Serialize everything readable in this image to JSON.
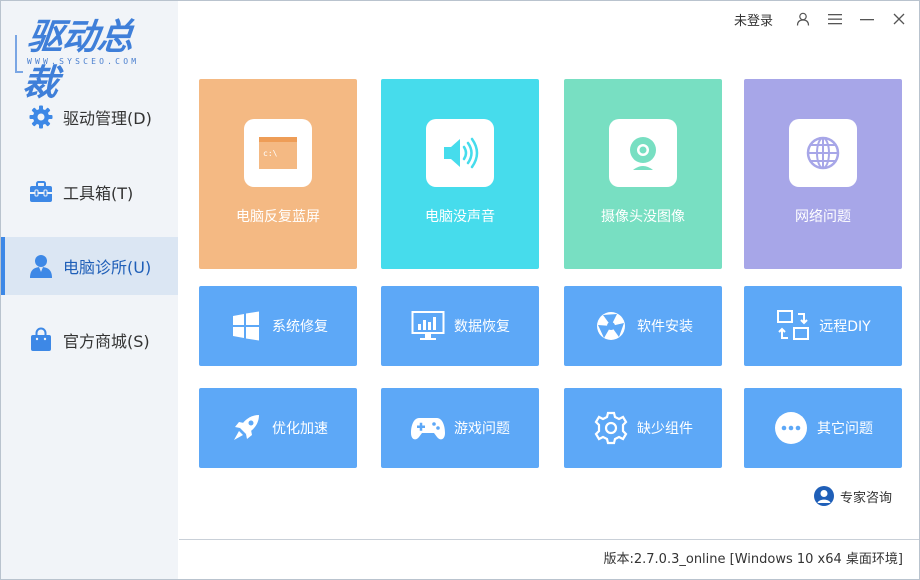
{
  "logo": {
    "main": "驱动总裁",
    "sub": "WWW.SYSCEO.COM"
  },
  "sidebar": {
    "items": [
      {
        "label": "驱动管理(D)",
        "icon": "gear-icon"
      },
      {
        "label": "工具箱(T)",
        "icon": "toolbox-icon"
      },
      {
        "label": "电脑诊所(U)",
        "icon": "doctor-icon",
        "active": true
      },
      {
        "label": "官方商城(S)",
        "icon": "shopping-bag-icon"
      }
    ]
  },
  "topbar": {
    "login": "未登录"
  },
  "tiles_big": [
    {
      "label": "电脑反复蓝屏",
      "color": "#f4b983",
      "icon": "blue-screen-window-icon"
    },
    {
      "label": "电脑没声音",
      "color": "#46dcec",
      "icon": "speaker-icon"
    },
    {
      "label": "摄像头没图像",
      "color": "#78dfc2",
      "icon": "webcam-icon"
    },
    {
      "label": "网络问题",
      "color": "#a7a6e8",
      "icon": "globe-icon"
    }
  ],
  "tiles_small": [
    {
      "label": "系统修复",
      "icon": "windows-icon"
    },
    {
      "label": "数据恢复",
      "icon": "monitor-chart-icon"
    },
    {
      "label": "软件安装",
      "icon": "aperture-icon"
    },
    {
      "label": "远程DIY",
      "icon": "remote-screens-icon"
    },
    {
      "label": "优化加速",
      "icon": "rocket-icon"
    },
    {
      "label": "游戏问题",
      "icon": "gamepad-icon"
    },
    {
      "label": "缺少组件",
      "icon": "gear-outline-icon"
    },
    {
      "label": "其它问题",
      "icon": "more-dots-icon"
    }
  ],
  "consult": {
    "label": "专家咨询"
  },
  "version": "版本:2.7.0.3_online [Windows 10 x64 桌面环境]",
  "colors": {
    "accent": "#3d88e6",
    "small_tile": "#5da8f7",
    "sidebar_bg": "#f1f4f8",
    "active_bg": "#dbe6f3"
  }
}
